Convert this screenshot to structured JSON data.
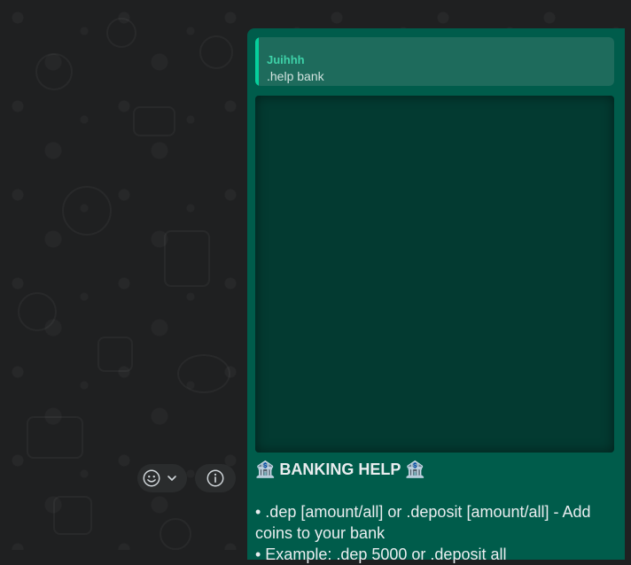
{
  "chat": {
    "message": {
      "quoted": {
        "author": "Juihhh",
        "text": ".help bank"
      },
      "media": {
        "icon": "image-placeholder"
      },
      "lines": {
        "title": "🏦 BANKING HELP 🏦",
        "line1": "• .dep [amount/all] or .deposit [amount/all] - Add",
        "line2": "coins to your bank",
        "line3": "• Example: .dep 5000 or .deposit all"
      }
    },
    "actions": {
      "react_icon": "smile-icon",
      "react_chevron_icon": "chevron-down-icon",
      "info_icon": "info-icon"
    }
  },
  "colors": {
    "background": "#1f2021",
    "bubble": "#005c4b",
    "quote_bg": "#1e6b5c",
    "quote_accent": "#06cf9c",
    "text": "#e9edef"
  }
}
